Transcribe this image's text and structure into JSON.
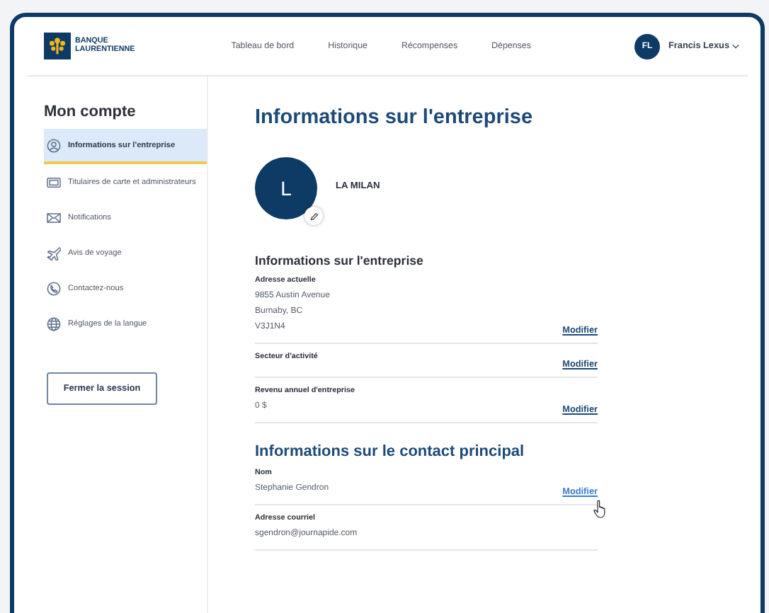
{
  "logo": {
    "line1": "BANQUE",
    "line2": "LAURENTIENNE"
  },
  "nav": [
    "Tableau de bord",
    "Historique",
    "Récompenses",
    "Dépenses"
  ],
  "user": {
    "initials": "FL",
    "name": "Francis Lexus"
  },
  "sidebar": {
    "title": "Mon compte",
    "items": [
      {
        "label": "Informations sur l'entreprise",
        "selected": true
      },
      {
        "label": "Titulaires de carte et administrateurs",
        "selected": false
      },
      {
        "label": "Notifications",
        "selected": false
      },
      {
        "label": "Avis de voyage",
        "selected": false
      },
      {
        "label": "Contactez-nous",
        "selected": false
      },
      {
        "label": "Réglages de la langue",
        "selected": false
      }
    ],
    "logout": "Fermer la session"
  },
  "main": {
    "title": "Informations sur l'entreprise",
    "company": {
      "initial": "L",
      "name": "LA MILAN"
    },
    "sections": [
      {
        "title": "Informations sur l'entreprise",
        "fields": [
          {
            "label": "Adresse actuelle",
            "lines": [
              "9855 Austin Avenue",
              "Burnaby, BC",
              "V3J1N4"
            ],
            "action": "Modifier",
            "hovered": false
          },
          {
            "label": "Secteur d'activité",
            "action": "Modifier",
            "hovered": false
          },
          {
            "label": "Revenu annuel d'entreprise",
            "lines": [
              "0 $"
            ],
            "action": "Modifier",
            "hovered": false
          }
        ]
      },
      {
        "title": "Informations sur le contact principal",
        "fields": [
          {
            "label": "Nom",
            "lines": [
              "Stephanie Gendron"
            ],
            "action": "Modifier",
            "hovered": true
          },
          {
            "label": "Adresse courriel",
            "lines": [
              "sgendron@journapide.com"
            ]
          }
        ]
      }
    ]
  }
}
